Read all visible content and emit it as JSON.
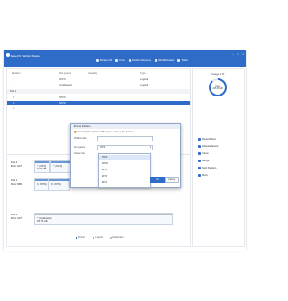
{
  "app": {
    "title": "EaseUS Partition Master",
    "window_controls": [
      "–",
      "□",
      "×"
    ]
  },
  "toolbar": [
    {
      "label": "Migrate OS",
      "icon": "migrate-icon"
    },
    {
      "label": "Clone",
      "icon": "clone-icon"
    },
    {
      "label": "Partition Recovery",
      "icon": "recovery-icon"
    },
    {
      "label": "WinPE Creator",
      "icon": "winpe-icon"
    },
    {
      "label": "Toolkit",
      "icon": "toolkit-icon"
    }
  ],
  "table": {
    "headers": [
      "Partition",
      "File system",
      "Capacity",
      "Type"
    ],
    "rows": [
      {
        "partition": "*:",
        "fs": "NTFS",
        "capacity": "",
        "type": "Logical"
      },
      {
        "partition": "*:",
        "fs": "Unallocated",
        "capacity": "",
        "type": "Logical"
      },
      {
        "partition": "Disk 1",
        "fs": "",
        "capacity": "",
        "type": ""
      },
      {
        "partition": "C:",
        "fs": "NTFS",
        "capacity": "",
        "type": ""
      },
      {
        "partition": "D:",
        "fs": "NTFS",
        "capacity": "",
        "type": ""
      },
      {
        "partition": "E:",
        "fs": "",
        "capacity": "",
        "type": ""
      },
      {
        "partition": "*:",
        "fs": "",
        "capacity": "",
        "type": ""
      }
    ]
  },
  "disk_map": {
    "disks": [
      {
        "label": "Disk 0\nBasic GPT",
        "size": "",
        "partitions": [
          {
            "text": "*: (NTFS)\n16.00 MB",
            "strip": "blue",
            "width_pct": 10
          },
          {
            "text": "*: (NTFS)",
            "strip": "blue",
            "width_pct": 22
          }
        ]
      },
      {
        "label": "Disk 1\nBasic MBR",
        "size": "",
        "partitions": [
          {
            "text": "C: (NTFS)",
            "strip": "blue",
            "width_pct": 9
          },
          {
            "text": "D: (NTFS)",
            "strip": "blue",
            "width_pct": 13
          }
        ]
      },
      {
        "label": "Disk 2\nBasic GPT",
        "size": "",
        "partitions": [
          {
            "text": "*: (Unallocated)\n465.76 GB",
            "strip": "gray",
            "width_pct": 88
          }
        ]
      }
    ],
    "legend": [
      {
        "label": "Primary",
        "color": "#2f6cc8"
      },
      {
        "label": "Logical",
        "color": "#8fb3e6"
      },
      {
        "label": "Unallocated",
        "color": "#b9bec6"
      }
    ]
  },
  "side": {
    "title": "Usage of D:",
    "used_label": "Used",
    "used_value": "415.33 GB",
    "usage_fraction": 0.88,
    "operations": [
      {
        "label": "Resize/Move",
        "icon": "resize-icon"
      },
      {
        "label": "Allocate Space",
        "icon": "allocate-icon"
      },
      {
        "label": "Clone",
        "icon": "clone-icon"
      },
      {
        "label": "Merge",
        "icon": "merge-icon"
      },
      {
        "label": "Split Partition",
        "icon": "split-icon"
      },
      {
        "label": "More",
        "icon": "more-icon"
      }
    ]
  },
  "dialog": {
    "title": "Format Partition",
    "warning": "Formatting the partition will destroy the data on the partition.",
    "label_field": "Partition label",
    "label_value": "",
    "fs_field": "File system",
    "fs_selected": "NTFS",
    "cluster_field": "Cluster size",
    "options": [
      "NTFS",
      "FAT32",
      "EXT2",
      "EXT3",
      "EXT4"
    ],
    "ok": "OK",
    "cancel": "Cancel"
  },
  "colors": {
    "accent": "#2f6cc8",
    "selected_row": "#2f6cc8",
    "warning": "#e6a21a"
  }
}
